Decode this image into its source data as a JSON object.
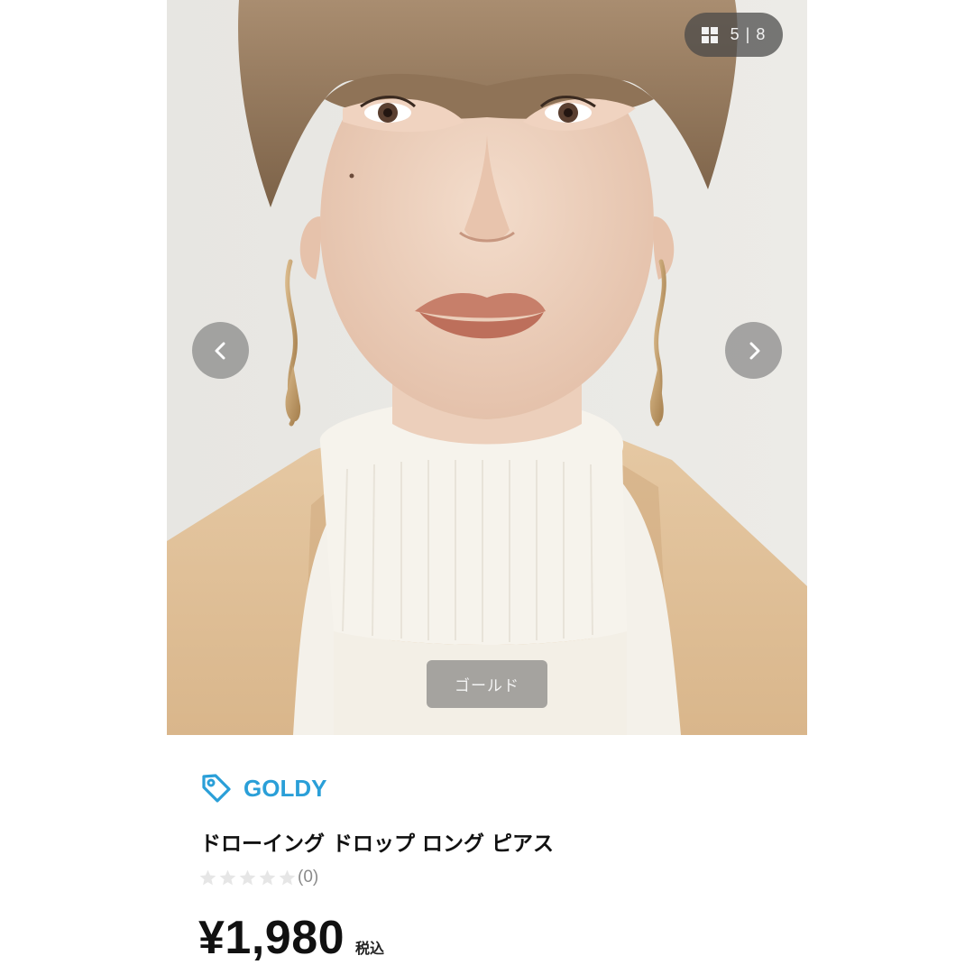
{
  "gallery": {
    "current_index": "5",
    "separator": "|",
    "total": "8",
    "color_label": "ゴールド",
    "overlay_color": "#464646"
  },
  "product": {
    "brand": "GOLDY",
    "brand_color": "#2a9fd8",
    "title": "ドローイング ドロップ ロング ピアス",
    "rating": 0,
    "review_count": "(0)",
    "price": "¥1,980",
    "tax_label": "税込"
  },
  "icons": {
    "gallery_grid": "grid-icon",
    "prev": "chevron-left-icon",
    "next": "chevron-right-icon",
    "brand": "tag-icon",
    "rating": "star-icon"
  }
}
